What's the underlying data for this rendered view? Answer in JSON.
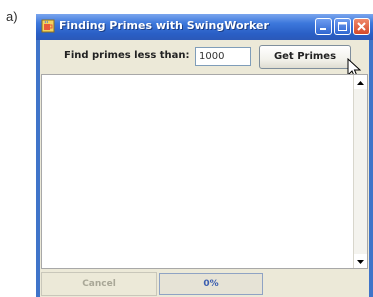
{
  "figure_label": "a)",
  "window": {
    "title": "Finding Primes with SwingWorker",
    "icon": "java-cup-icon",
    "controls": [
      "minimize-icon",
      "maximize-icon",
      "close-icon"
    ],
    "title_color": "#ffffff",
    "titlebar_color": "#3d78dc"
  },
  "toolbar": {
    "prompt_label": "Find primes less than:",
    "input_value": "1000",
    "get_button_label": "Get Primes"
  },
  "results": {
    "text": ""
  },
  "status": {
    "cancel_label": "Cancel",
    "progress_text": "0%",
    "progress_fraction": 0
  }
}
